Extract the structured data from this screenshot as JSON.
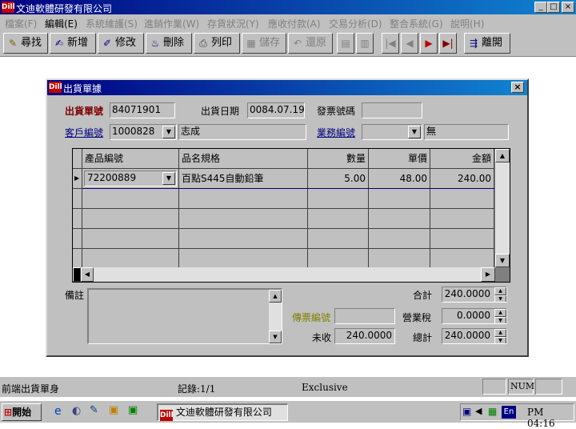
{
  "app": {
    "title": "文迪軟體研發有限公司",
    "logo": "Dill"
  },
  "window_controls": {
    "minimize": "_",
    "maximize": "□",
    "close": "×"
  },
  "menu": [
    {
      "label": "檔案(F)",
      "active": false
    },
    {
      "label": "編輯(E)",
      "active": true
    },
    {
      "label": "系統維護(S)",
      "active": false
    },
    {
      "label": "進銷作業(W)",
      "active": false
    },
    {
      "label": "存貨狀況(Y)",
      "active": false
    },
    {
      "label": "應收付款(A)",
      "active": false
    },
    {
      "label": "交易分析(D)",
      "active": false
    },
    {
      "label": "整合系統(G)",
      "active": false
    },
    {
      "label": "說明(H)",
      "active": false
    }
  ],
  "toolbar": {
    "find": "尋找",
    "add": "新增",
    "edit": "修改",
    "delete": "刪除",
    "print": "列印",
    "save": "儲存",
    "restore": "還原",
    "exit": "離開"
  },
  "dialog": {
    "title": "出貨單據",
    "order_no_label": "出貨單號",
    "order_no": "84071901",
    "ship_date_label": "出貨日期",
    "ship_date": "0084.07.19",
    "invoice_no_label": "發票號碼",
    "invoice_no": "",
    "customer_label": "客戶編號",
    "customer_code": "1000828",
    "customer_name": "志成",
    "sales_label": "業務編號",
    "sales_code": "",
    "sales_name": "無",
    "grid": {
      "headers": [
        "產品編號",
        "品名規格",
        "數量",
        "單價",
        "金額"
      ],
      "rows": [
        [
          "72200889",
          "百點S445自動鉛筆",
          "5.00",
          "48.00",
          "240.00"
        ]
      ]
    },
    "remarks_label": "備註",
    "remarks": "",
    "voucher_label": "傳票編號",
    "voucher_no": "",
    "unreceived_label": "未收",
    "unreceived": "240.0000",
    "subtotal_label": "合計",
    "subtotal": "240.0000",
    "tax_label": "營業稅",
    "tax": "0.0000",
    "total_label": "總計",
    "total": "240.0000"
  },
  "status": {
    "form": "前端出貨單身",
    "record": "記錄:1/1",
    "mode": "Exclusive",
    "num": "NUM"
  },
  "taskbar": {
    "start": "開始",
    "task": "文迪軟體研發有限公司",
    "lang": "En",
    "time": "PM 04:16"
  },
  "colors": {
    "title_blue": "#000080",
    "required_label": "#800000",
    "link_label": "#000080",
    "voucher_label": "#808000",
    "face": "#c0c0c0"
  }
}
